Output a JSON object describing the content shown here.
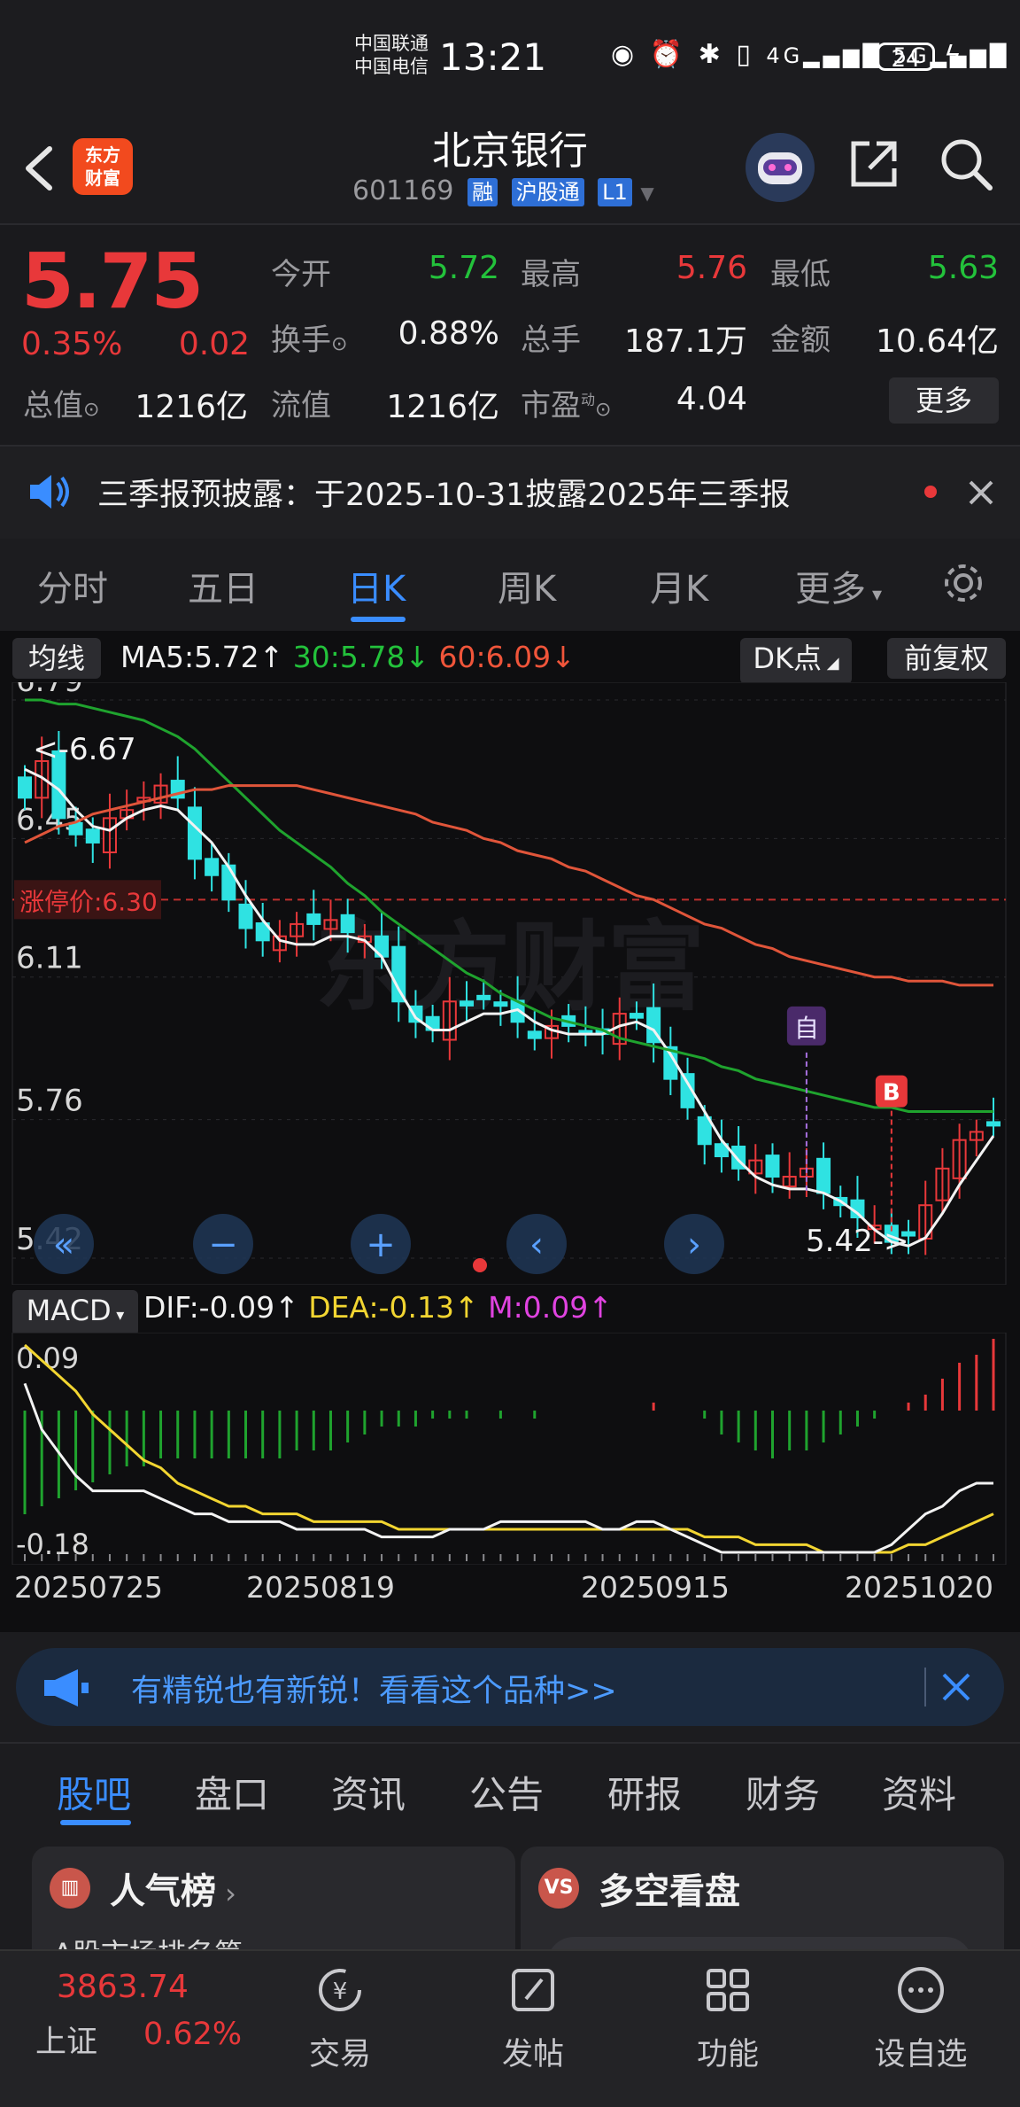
{
  "status_bar": {
    "carrier1": "中国联通",
    "carrier2": "中国电信",
    "time": "13:21",
    "battery": "24"
  },
  "header": {
    "logo_line1": "东方",
    "logo_line2": "财富",
    "title": "北京银行",
    "code": "601169",
    "tags": [
      "融",
      "沪股通",
      "L1"
    ]
  },
  "quote": {
    "price": "5.75",
    "change_pct": "0.35%",
    "change": "0.02",
    "rows": [
      [
        {
          "label": "今开",
          "value": "5.72",
          "color": "green"
        },
        {
          "label": "最高",
          "value": "5.76",
          "color": "red"
        },
        {
          "label": "最低",
          "value": "5.63",
          "color": "green"
        }
      ],
      [
        {
          "label": "换手",
          "value": "0.88%",
          "color": "white"
        },
        {
          "label": "总手",
          "value": "187.1万",
          "color": "white"
        },
        {
          "label": "金额",
          "value": "10.64亿",
          "color": "white"
        }
      ],
      [
        {
          "label": "总值",
          "value": "1216亿",
          "color": "white"
        },
        {
          "label": "流值",
          "value": "1216亿",
          "color": "white"
        },
        {
          "label": "市盈",
          "value": "4.04",
          "color": "white"
        }
      ]
    ],
    "pe_sup": "动",
    "more_label": "更多"
  },
  "notice": {
    "text": "三季报预披露：于2025-10-31披露2025年三季报"
  },
  "kline_tabs": [
    "分时",
    "五日",
    "日K",
    "周K",
    "月K",
    "更多"
  ],
  "kline_active": 2,
  "ma_bar": {
    "type_label": "均线",
    "ma5": "MA5:5.72↑",
    "ma30": "30:5.78↓",
    "ma60": "60:6.09↓",
    "dk_label": "DK点",
    "adjust_label": "前复权"
  },
  "price_chart": {
    "y_labels": [
      "6.79",
      "6.45",
      "6.11",
      "5.76",
      "5.42"
    ],
    "limit_label": "涨停价:6.30",
    "high_marker": "<-6.67",
    "low_marker": "5.42->",
    "self_marker": "自",
    "buy_marker": "B",
    "watermark": "东方财富"
  },
  "macd_bar": {
    "name": "MACD",
    "dif": "DIF:-0.09↑",
    "dea": "DEA:-0.13↑",
    "m": "M:0.09↑",
    "y_top": "0.09",
    "y_bottom": "-0.18"
  },
  "dates": [
    "20250725",
    "20250819",
    "20250915",
    "20251020"
  ],
  "chart_data": {
    "type": "line",
    "title": "",
    "ylim": [
      5.42,
      6.79
    ],
    "y_ticks": [
      6.79,
      6.45,
      6.11,
      5.76,
      5.42
    ],
    "x_ticks": [
      "20250725",
      "20250819",
      "20250915",
      "20251020"
    ],
    "series": [
      {
        "name": "MA5",
        "values": [
          6.62,
          6.6,
          6.57,
          6.52,
          6.48,
          6.47,
          6.5,
          6.52,
          6.53,
          6.52,
          6.48,
          6.44,
          6.38,
          6.31,
          6.25,
          6.2,
          6.19,
          6.19,
          6.21,
          6.21,
          6.2,
          6.16,
          6.08,
          6.01,
          5.98,
          5.98,
          6.0,
          6.02,
          6.02,
          6.03,
          6.0,
          5.98,
          5.97,
          5.97,
          5.97,
          5.99,
          6.0,
          5.98,
          5.92,
          5.85,
          5.78,
          5.71,
          5.66,
          5.62,
          5.6,
          5.59,
          5.59,
          5.58,
          5.56,
          5.53,
          5.49,
          5.46,
          5.45,
          5.47,
          5.53,
          5.6,
          5.66,
          5.72
        ]
      },
      {
        "name": "30",
        "values": [
          6.79,
          6.79,
          6.78,
          6.78,
          6.77,
          6.76,
          6.75,
          6.74,
          6.72,
          6.7,
          6.67,
          6.63,
          6.59,
          6.55,
          6.51,
          6.47,
          6.44,
          6.41,
          6.38,
          6.34,
          6.31,
          6.27,
          6.24,
          6.21,
          6.18,
          6.15,
          6.12,
          6.1,
          6.07,
          6.05,
          6.03,
          6.01,
          6.0,
          5.99,
          5.98,
          5.96,
          5.95,
          5.94,
          5.93,
          5.92,
          5.91,
          5.89,
          5.88,
          5.86,
          5.85,
          5.84,
          5.83,
          5.82,
          5.81,
          5.8,
          5.79,
          5.79,
          5.78,
          5.78,
          5.78,
          5.78,
          5.78,
          5.78
        ]
      },
      {
        "name": "60",
        "values": [
          6.44,
          6.46,
          6.48,
          6.49,
          6.51,
          6.52,
          6.53,
          6.54,
          6.55,
          6.56,
          6.57,
          6.57,
          6.58,
          6.58,
          6.58,
          6.58,
          6.58,
          6.57,
          6.56,
          6.55,
          6.54,
          6.53,
          6.52,
          6.51,
          6.49,
          6.48,
          6.47,
          6.45,
          6.44,
          6.42,
          6.41,
          6.4,
          6.38,
          6.37,
          6.35,
          6.33,
          6.31,
          6.3,
          6.28,
          6.26,
          6.24,
          6.23,
          6.21,
          6.19,
          6.18,
          6.16,
          6.15,
          6.14,
          6.13,
          6.12,
          6.11,
          6.11,
          6.1,
          6.1,
          6.1,
          6.09,
          6.09,
          6.09
        ]
      }
    ],
    "candles_close": [
      6.55,
      6.64,
      6.5,
      6.46,
      6.44,
      6.5,
      6.52,
      6.55,
      6.58,
      6.55,
      6.4,
      6.36,
      6.3,
      6.23,
      6.2,
      6.21,
      6.24,
      6.24,
      6.25,
      6.22,
      6.21,
      6.16,
      6.05,
      6.0,
      5.98,
      6.05,
      6.04,
      6.06,
      6.04,
      6.0,
      5.96,
      5.99,
      5.99,
      5.97,
      5.97,
      6.02,
      6.01,
      5.95,
      5.86,
      5.79,
      5.7,
      5.67,
      5.64,
      5.66,
      5.62,
      5.62,
      5.64,
      5.58,
      5.55,
      5.52,
      5.5,
      5.46,
      5.48,
      5.55,
      5.64,
      5.71,
      5.73,
      5.75
    ]
  },
  "macd_chart": {
    "ylim": [
      -0.18,
      0.09
    ],
    "hist": [
      -0.13,
      -0.12,
      -0.11,
      -0.1,
      -0.09,
      -0.08,
      -0.07,
      -0.07,
      -0.06,
      -0.06,
      -0.06,
      -0.06,
      -0.06,
      -0.06,
      -0.06,
      -0.06,
      -0.05,
      -0.05,
      -0.05,
      -0.04,
      -0.03,
      -0.02,
      -0.02,
      -0.02,
      -0.01,
      -0.01,
      -0.01,
      0.0,
      -0.01,
      0.0,
      -0.01,
      0.0,
      0.0,
      0.0,
      0.0,
      0.0,
      0.0,
      0.01,
      0.0,
      0.0,
      -0.01,
      -0.03,
      -0.04,
      -0.05,
      -0.06,
      -0.05,
      -0.05,
      -0.04,
      -0.03,
      -0.02,
      -0.01,
      0.0,
      0.01,
      0.02,
      0.04,
      0.06,
      0.07,
      0.09
    ],
    "dif": [
      0.04,
      -0.02,
      -0.05,
      -0.08,
      -0.1,
      -0.1,
      -0.1,
      -0.1,
      -0.11,
      -0.12,
      -0.13,
      -0.13,
      -0.14,
      -0.14,
      -0.14,
      -0.14,
      -0.15,
      -0.15,
      -0.15,
      -0.15,
      -0.15,
      -0.16,
      -0.16,
      -0.16,
      -0.16,
      -0.15,
      -0.15,
      -0.15,
      -0.14,
      -0.14,
      -0.14,
      -0.14,
      -0.14,
      -0.14,
      -0.15,
      -0.15,
      -0.14,
      -0.14,
      -0.15,
      -0.16,
      -0.17,
      -0.18,
      -0.18,
      -0.18,
      -0.18,
      -0.18,
      -0.18,
      -0.18,
      -0.18,
      -0.18,
      -0.18,
      -0.17,
      -0.15,
      -0.13,
      -0.12,
      -0.1,
      -0.09,
      -0.09
    ],
    "dea": [
      0.09,
      0.07,
      0.05,
      0.03,
      0.0,
      -0.02,
      -0.04,
      -0.06,
      -0.07,
      -0.09,
      -0.1,
      -0.11,
      -0.12,
      -0.12,
      -0.13,
      -0.13,
      -0.13,
      -0.14,
      -0.14,
      -0.14,
      -0.14,
      -0.14,
      -0.15,
      -0.15,
      -0.15,
      -0.15,
      -0.15,
      -0.15,
      -0.15,
      -0.15,
      -0.15,
      -0.15,
      -0.15,
      -0.15,
      -0.15,
      -0.15,
      -0.15,
      -0.15,
      -0.15,
      -0.15,
      -0.16,
      -0.16,
      -0.16,
      -0.17,
      -0.17,
      -0.17,
      -0.17,
      -0.18,
      -0.18,
      -0.18,
      -0.18,
      -0.18,
      -0.17,
      -0.17,
      -0.16,
      -0.15,
      -0.14,
      -0.13
    ]
  },
  "ad_banner": {
    "text": "有精锐也有新锐！看看这个品种>>"
  },
  "info_tabs": [
    "股吧",
    "盘口",
    "资讯",
    "公告",
    "研报",
    "财务",
    "资料"
  ],
  "cards": [
    {
      "title": "人气榜",
      "icon": "chart-icon",
      "sub": "A股市场排名第"
    },
    {
      "title": "多空看盘",
      "icon": "vs-icon",
      "sub": ""
    }
  ],
  "bottom_nav": {
    "index_value": "3863.74",
    "index_name": "上证",
    "index_change": "0.62%",
    "items": [
      "交易",
      "发帖",
      "功能",
      "设自选"
    ]
  }
}
